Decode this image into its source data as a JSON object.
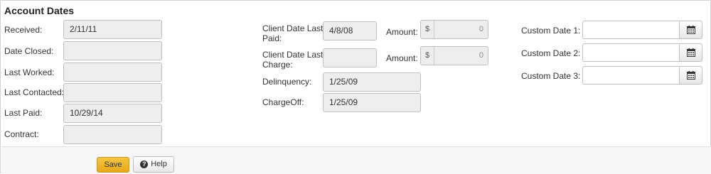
{
  "section": {
    "title": "Account Dates"
  },
  "left": {
    "received": {
      "label": "Received:",
      "value": "2/11/11"
    },
    "date_closed": {
      "label": "Date Closed:",
      "value": ""
    },
    "last_worked": {
      "label": "Last Worked:",
      "value": ""
    },
    "last_contacted": {
      "label": "Last Contacted:",
      "value": ""
    },
    "last_paid": {
      "label": "Last Paid:",
      "value": "10/29/14"
    },
    "contract": {
      "label": "Contract:",
      "value": ""
    }
  },
  "middle": {
    "client_date_last_paid": {
      "label_line1": "Client Date Last",
      "label_line2": "Paid:",
      "value": "4/8/08"
    },
    "client_date_last_charge": {
      "label_line1": "Client Date Last",
      "label_line2": "Charge:",
      "value": ""
    },
    "delinquency": {
      "label": "Delinquency:",
      "value": "1/25/09"
    },
    "chargeoff": {
      "label": "ChargeOff:",
      "value": "1/25/09"
    },
    "amount_paid": {
      "label": "Amount:",
      "currency": "$",
      "value": "0"
    },
    "amount_charge": {
      "label": "Amount:",
      "currency": "$",
      "value": "0"
    }
  },
  "right": {
    "custom_date_1": {
      "label": "Custom Date 1:",
      "value": ""
    },
    "custom_date_2": {
      "label": "Custom Date 2:",
      "value": ""
    },
    "custom_date_3": {
      "label": "Custom Date 3:",
      "value": ""
    },
    "icon": "calendar-icon"
  },
  "footer": {
    "save_label": "Save",
    "help_label": "Help",
    "help_icon": "question-circle-icon",
    "save_color": "#f0b429"
  }
}
